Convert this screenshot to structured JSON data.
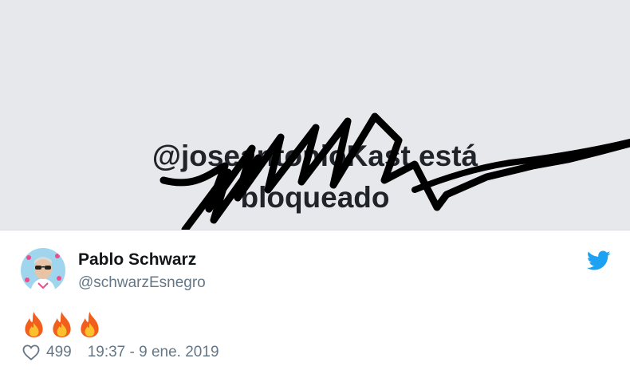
{
  "blocked_banner": {
    "line1": "@joseantonioKast está",
    "line2": "bloqueado",
    "background": "#e6e8ec"
  },
  "tweet": {
    "author_name": "Pablo Schwarz",
    "author_handle": "@schwarzEsnegro",
    "body_emoji": [
      "fire-emoji",
      "fire-emoji",
      "fire-emoji"
    ],
    "like_count": "499",
    "timestamp": "19:37 - 9 ene. 2019",
    "brand_color": "#1da1f2",
    "icons": [
      "twitter-bird-icon",
      "heart-icon"
    ]
  }
}
